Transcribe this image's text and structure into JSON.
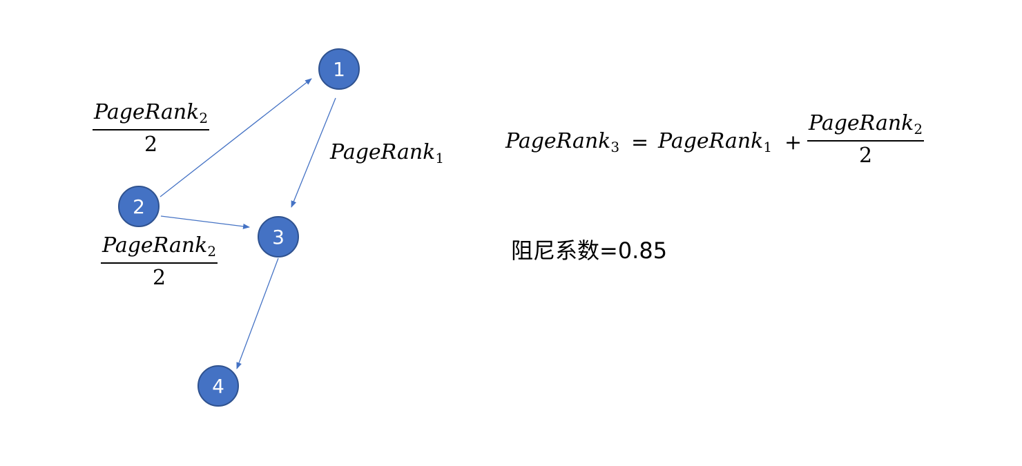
{
  "graph": {
    "nodes": [
      {
        "id": "1",
        "label": "1"
      },
      {
        "id": "2",
        "label": "2"
      },
      {
        "id": "3",
        "label": "3"
      },
      {
        "id": "4",
        "label": "4"
      }
    ],
    "edges": [
      {
        "from": "2",
        "to": "1"
      },
      {
        "from": "2",
        "to": "3"
      },
      {
        "from": "1",
        "to": "3"
      },
      {
        "from": "3",
        "to": "4"
      }
    ],
    "node_color": "#4472c4",
    "edge_color": "#4472c4"
  },
  "labels": {
    "edge_2_1": {
      "numerator": "PageRank",
      "numerator_sub": "2",
      "denominator": "2"
    },
    "edge_2_3": {
      "numerator": "PageRank",
      "numerator_sub": "2",
      "denominator": "2"
    },
    "edge_1_3": {
      "text": "PageRank",
      "sub": "1"
    }
  },
  "formula": {
    "lhs": "PageRank",
    "lhs_sub": "3",
    "equals": "=",
    "term1": "PageRank",
    "term1_sub": "1",
    "plus": "+",
    "frac_numerator": "PageRank",
    "frac_numerator_sub": "2",
    "frac_denominator": "2"
  },
  "damping_text": "阻尼系数=0.85"
}
